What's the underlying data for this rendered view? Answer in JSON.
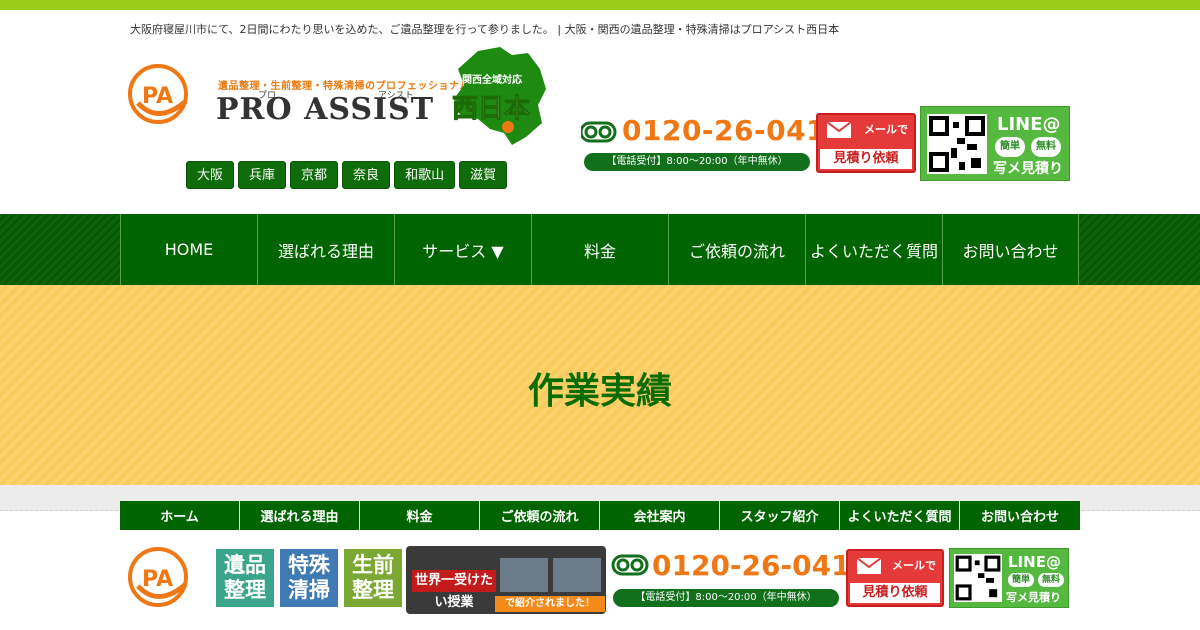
{
  "tagline": "大阪府寝屋川市にて、2日間にわたり思いを込めた、ご遺品整理を行って参りました。 | 大阪・関西の遺品整理・特殊清掃はプロアシスト西日本",
  "logo": {
    "subtitle": "遺品整理・生前整理・特殊清掃のプロフェッショナル",
    "ruby_pro": "プロ",
    "ruby_assist": "アシスト",
    "name": "PRO ASSIST",
    "map_top": "関西全域対応",
    "map_main": "西日本"
  },
  "regions": [
    "大阪",
    "兵庫",
    "京都",
    "奈良",
    "和歌山",
    "滋賀"
  ],
  "phone": {
    "number": "0120-26-0410",
    "hours": "【電話受付】8:00～20:00（年中無休）"
  },
  "mail_button": {
    "top": "メールで",
    "bottom": "見積り依頼"
  },
  "line_button": {
    "title": "LINE@",
    "tag1": "簡単",
    "tag2": "無料",
    "bottom": "写メ見積り"
  },
  "nav": [
    "HOME",
    "選ばれる理由",
    "サービス ▼",
    "料金",
    "ご依頼の流れ",
    "よくいただく質問",
    "お問い合わせ"
  ],
  "hero": {
    "title": "作業実績"
  },
  "subnav": [
    "ホーム",
    "選ばれる理由",
    "料金",
    "ご依頼の流れ",
    "会社案内",
    "スタッフ紹介",
    "よくいただく質問",
    "お問い合わせ"
  ],
  "footer": {
    "tiles": [
      {
        "text": "遺品整理",
        "color": "#3aa58a"
      },
      {
        "text": "特殊清掃",
        "color": "#3f7ab4"
      },
      {
        "text": "生前整理",
        "color": "#7aa832"
      }
    ],
    "tv_title": "世界一受けたい授業",
    "tv_note": "で紹介されました！",
    "phone_number": "0120-26-0410",
    "phone_hours": "【電話受付】8:00～20:00（年中無休）",
    "mail_top": "メールで",
    "mail_bottom": "見積り依頼",
    "line_title": "LINE@",
    "line_tag1": "簡単",
    "line_tag2": "無料",
    "line_bottom": "写メ見積り"
  },
  "colors": {
    "green": "#006400",
    "orange": "#f07814",
    "hero_yellow": "#fcd26c",
    "top_bar": "#9ccc1a"
  }
}
